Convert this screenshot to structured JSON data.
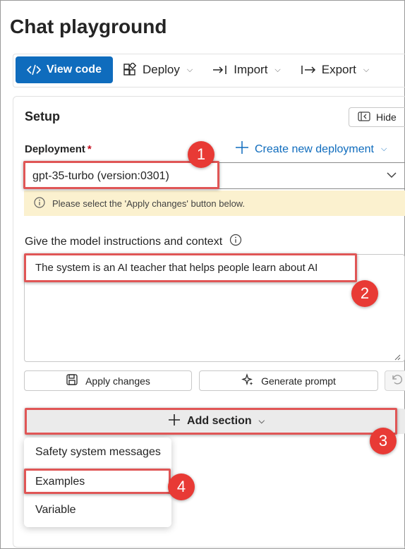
{
  "page": {
    "title": "Chat playground"
  },
  "toolbar": {
    "view_code": "View code",
    "deploy": "Deploy",
    "import": "Import",
    "export": "Export"
  },
  "setup": {
    "title": "Setup",
    "hide": "Hide",
    "deployment_label": "Deployment",
    "required_mark": "*",
    "create_new": "Create new deployment",
    "deployment_value": "gpt-35-turbo (version:0301)",
    "warning": "Please select the 'Apply changes' button below.",
    "instructions_label": "Give the model instructions and context",
    "instructions_value": "The system is an AI teacher that helps people learn about AI",
    "apply_changes": "Apply changes",
    "generate_prompt": "Generate prompt",
    "add_section": "Add section"
  },
  "menu": {
    "items": [
      "Safety system messages",
      "Examples",
      "Variable"
    ]
  },
  "badges": [
    "1",
    "2",
    "3",
    "4"
  ],
  "colors": {
    "primary": "#0f6cbd",
    "highlight": "#e05656",
    "badge": "#e83a35",
    "warning_bg": "#fbf1cf",
    "required": "#c50f1f"
  }
}
